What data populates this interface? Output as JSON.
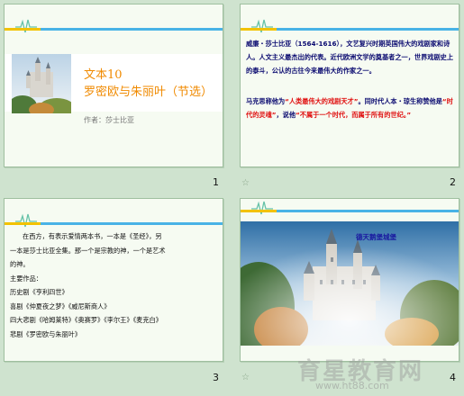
{
  "slides": [
    {
      "number": "1",
      "title_line1": "文本10",
      "title_line2": "罗密欧与朱丽叶（节选）",
      "author": "作者：莎士比亚"
    },
    {
      "number": "2",
      "para1": "威廉・莎士比亚（1564-1616），文艺复兴时期英国伟大的戏剧家和诗人。人文主义最杰出的代表。近代欧洲文学的奠基者之一，世界戏剧史上的泰斗，公认的古往今来最伟大的作家之一。",
      "para2_a": "马克思称他为",
      "para2_red1": "“人类最伟大的戏剧天才”",
      "para2_b": "。同时代人本・琼生称赞他是",
      "para2_red2": "“时代的灵魂”",
      "para2_c": "，说他",
      "para2_red3": "“不属于一个时代，而属于所有的世纪。”"
    },
    {
      "number": "3",
      "lines": [
        "在西方，有表示爱情两本书，一本是《圣经》，另",
        "一本是莎士比亚全集。那一个是宗教的神，一个是艺术",
        "的神。",
        "主要作品：",
        "历史剧《亨利四世》",
        "喜剧《仲夏夜之梦》《威尼斯商人》",
        "四大悲剧《哈姆莱特》《奥赛罗》《李尔王》《麦克白》",
        "悲剧《罗密欧与朱丽叶》"
      ]
    },
    {
      "number": "4",
      "caption": "德天鹅堡城堡"
    }
  ],
  "watermark": {
    "text": "育星教育网",
    "url": "www.ht88.com"
  },
  "colors": {
    "accent_orange": "#f08a00",
    "text_blue": "#0a0a70",
    "text_red": "#e01010",
    "line_blue": "#49b3e6",
    "line_yellow": "#f2c200"
  }
}
